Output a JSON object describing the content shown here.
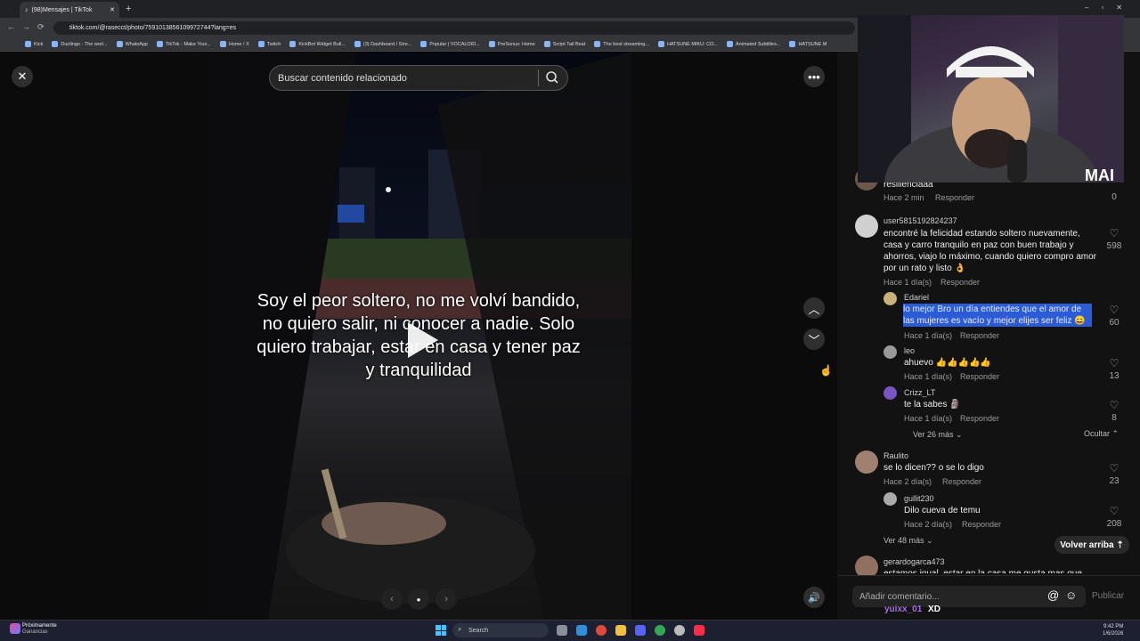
{
  "browser": {
    "tab_title": "(98)Mensajes | TikTok",
    "url": "tiktok.com/@rasecct/photo/7591013856109972744?lang=es",
    "bookmarks": [
      "Kick",
      "Duolingo - The worl...",
      "WhatsApp",
      "TikTok - Make Your...",
      "Home / X",
      "Twitch",
      "KickBot Widget Buil...",
      "(3) Dashboard / Stre...",
      "Popular | VOCALOID...",
      "PreSonus: Home",
      "Script Tail Beat",
      "The best streaming...",
      "HATSUNE MIKU: CO...",
      "Animated Subtitles...",
      "HATSUNE M"
    ]
  },
  "viewer": {
    "search_placeholder": "Buscar contenido relacionado",
    "caption_lines": [
      "Soy el peor soltero, no me volví bandido,",
      "no quiero salir, ni conocer a nadie. Solo",
      "quiero trabajar, estar en casa y tener paz",
      "y tranquilidad"
    ]
  },
  "webcam": {
    "watermark": "MAI"
  },
  "comments": {
    "top_partial": {
      "text": "resilienciaaa",
      "time": "Hace 2 min",
      "reply": "Responder",
      "likes": "0"
    },
    "c1": {
      "user": "user5815192824237",
      "text": "encontré la felicidad estando soltero nuevamente, casa y carro tranquilo en paz con buen trabajo y ahorros, viajo lo máximo, cuando quiero compro amor por un rato y listo 👌",
      "time": "Hace 1 día(s)",
      "reply": "Responder",
      "likes": "598",
      "replies": [
        {
          "user": "Edariel",
          "text": "lo mejor Bro un día entiendes que el amor de las mujeres es vacío y mejor elijes ser feliz 😄",
          "time": "Hace 1 día(s)",
          "reply": "Responder",
          "likes": "60"
        },
        {
          "user": "leo",
          "text": "ahuevo 👍👍👍👍👍",
          "time": "Hace 1 día(s)",
          "reply": "Responder",
          "likes": "13"
        },
        {
          "user": "Crizz_LT",
          "text": "te la sabes 🗿",
          "time": "Hace 1 día(s)",
          "reply": "Responder",
          "likes": "8"
        }
      ],
      "more": "Ver 26 más",
      "hide": "Ocultar"
    },
    "c2": {
      "user": "Raulito",
      "text": "se lo dicen?? o se lo digo",
      "time": "Hace 2 día(s)",
      "reply": "Responder",
      "likes": "23",
      "replies": [
        {
          "user": "gullit230",
          "text": "Dilo cueva de temu",
          "time": "Hace 2 día(s)",
          "reply": "Responder",
          "likes": "208"
        }
      ],
      "more": "Ver 48 más"
    },
    "back_to_top": "Volver arriba",
    "c3": {
      "user": "gerardogarca473",
      "text": "estamos igual, estar en la casa me gusta mas que"
    },
    "input_placeholder": "Añadir comentario...",
    "publish": "Publicar",
    "chat_overlay": {
      "user": "yuixx_01",
      "msg": "XD"
    }
  },
  "taskbar": {
    "notif_title": "Próximamente",
    "notif_sub": "Ganancias",
    "search": "Search",
    "time": "9:42 PM",
    "date": "1/6/2026"
  },
  "colors": {
    "accent": "#1a73e8",
    "highlight": "#2b5cd6",
    "bg": "#121212"
  }
}
